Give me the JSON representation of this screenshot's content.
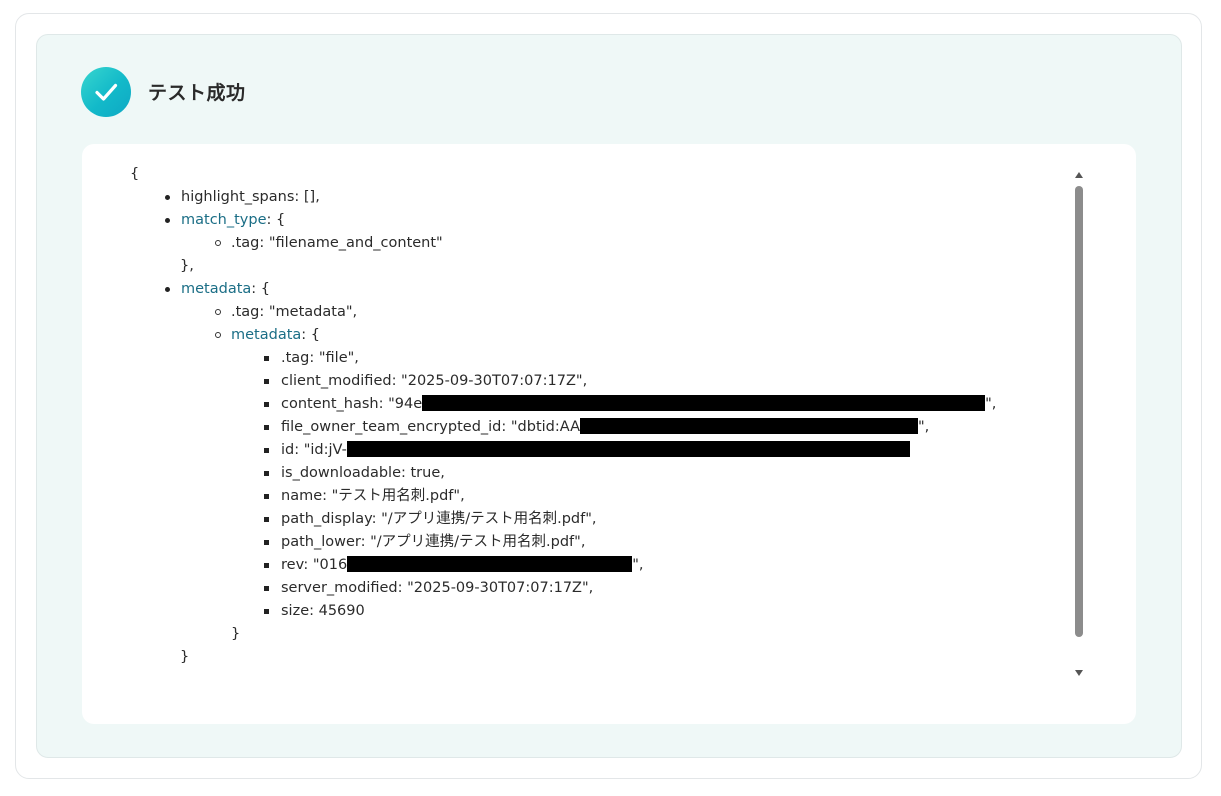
{
  "header": {
    "title": "テスト成功",
    "icon": "check-circle-icon"
  },
  "json_view": {
    "open_brace": "{",
    "highlight_spans": "highlight_spans: [],",
    "match_type_key": "match_type",
    "match_type_open": ": {",
    "match_type_tag": ".tag: \"filename_and_content\"",
    "match_type_close": "},",
    "metadata_key": "metadata",
    "metadata_open": ": {",
    "metadata_tag": ".tag: \"metadata\",",
    "inner_metadata_key": "metadata",
    "inner_metadata_open": ": {",
    "fields": {
      "tag": ".tag: \"file\",",
      "client_modified": "client_modified: \"2025-09-30T07:07:17Z\",",
      "content_hash_prefix": "content_hash: \"94e",
      "content_hash_suffix": "\",",
      "file_owner_prefix": "file_owner_team_encrypted_id: \"dbtid:AA",
      "file_owner_suffix": "\",",
      "id_prefix": "id: \"id:jV-",
      "is_downloadable": "is_downloadable: true,",
      "name": "name: \"テスト用名刺.pdf\",",
      "path_display": "path_display: \"/アプリ連携/テスト用名刺.pdf\",",
      "path_lower": "path_lower: \"/アプリ連携/テスト用名刺.pdf\",",
      "rev_prefix": "rev: \"016",
      "rev_suffix": "\",",
      "server_modified": "server_modified: \"2025-09-30T07:07:17Z\",",
      "size": "size: 45690"
    },
    "inner_close": "}",
    "metadata_close": "}"
  },
  "colors": {
    "panel_bg": "#eff8f7",
    "key_link": "#1b6e86",
    "check_gradient_start": "#38d6cf",
    "check_gradient_end": "#0fa8c4"
  }
}
